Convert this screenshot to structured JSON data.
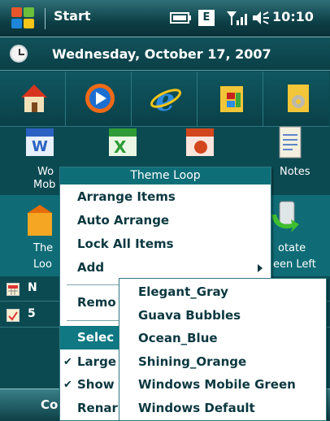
{
  "titlebar": {
    "start_label": "Start",
    "clock": "10:10",
    "status_icons": [
      "battery-icon",
      "e-icon",
      "signal-icon",
      "volume-icon"
    ]
  },
  "today": {
    "date": "Wednesday, October 17, 2007"
  },
  "tiles_row1": [
    "home-icon",
    "media-player-icon",
    "internet-explorer-icon",
    "office-folder-icon",
    "settings-folder-icon"
  ],
  "tiles_row2": {
    "left_label_line1": "Wo",
    "left_label_line2": "Mob",
    "right_label": "Notes",
    "icons": [
      "word-icon",
      "excel-icon",
      "powerpoint-icon",
      "notes-icon"
    ]
  },
  "tiles_row3": {
    "left_label_line1": "The",
    "left_label_line2": "Loo",
    "right_label_line1": "otate",
    "right_label_line2": "een Left",
    "icons": [
      "theme-loop-icon",
      "rotate-screen-icon"
    ]
  },
  "lower": {
    "calendar_label": "N",
    "tasks_label": "5"
  },
  "softkeys": {
    "left_label": "Co"
  },
  "menu": {
    "title": "Theme Loop",
    "items": [
      {
        "label": "Arrange Items"
      },
      {
        "label": "Auto Arrange"
      },
      {
        "label": "Lock All Items"
      },
      {
        "label": "Add"
      },
      {
        "label": "Remo"
      },
      {
        "label": "Selec"
      },
      {
        "label": "Large"
      },
      {
        "label": "Show"
      },
      {
        "label": "Renar"
      }
    ]
  },
  "submenu": {
    "items": [
      "Elegant_Gray",
      "Guava Bubbles",
      "Ocean_Blue",
      "Shining_Orange",
      "Windows Mobile Green",
      "Windows Default"
    ]
  },
  "colors": {
    "accent": "#0f7883",
    "background": "#0c4a52",
    "menu_text": "#0b3840"
  }
}
